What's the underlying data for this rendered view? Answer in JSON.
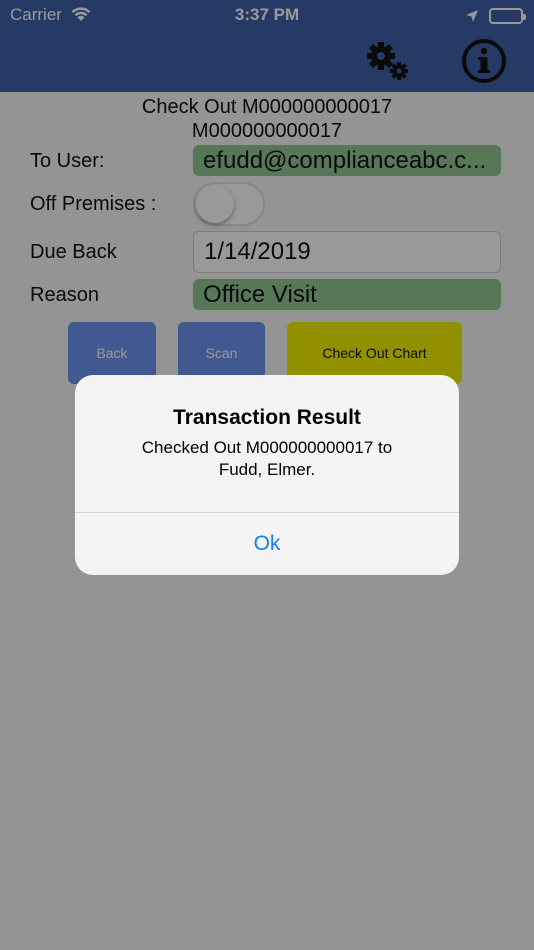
{
  "status_bar": {
    "carrier": "Carrier",
    "time": "3:37 PM"
  },
  "nav": {
    "settings_icon": "gear-icon",
    "info_icon": "info-icon"
  },
  "form": {
    "title_line1": "Check Out M000000000017",
    "title_line2": "M000000000017",
    "to_user_label": "To User:",
    "to_user_value": "efudd@complianceabc.c...",
    "off_premises_label": "Off Premises :",
    "off_premises_on": false,
    "due_back_label": "Due Back",
    "due_back_value": "1/14/2019",
    "reason_label": "Reason",
    "reason_value": "Office Visit"
  },
  "buttons": {
    "back": "Back",
    "scan": "Scan",
    "check_out_chart": "Check Out Chart"
  },
  "alert": {
    "title": "Transaction Result",
    "message_line1": "Checked Out M000000000017 to",
    "message_line2": "Fudd, Elmer.",
    "ok": "Ok"
  },
  "colors": {
    "nav": "#3f63a8",
    "field_green": "#92c692",
    "button_blue": "#6b94f0",
    "button_yellow": "#f2f200",
    "alert_action": "#1a7cf5"
  }
}
